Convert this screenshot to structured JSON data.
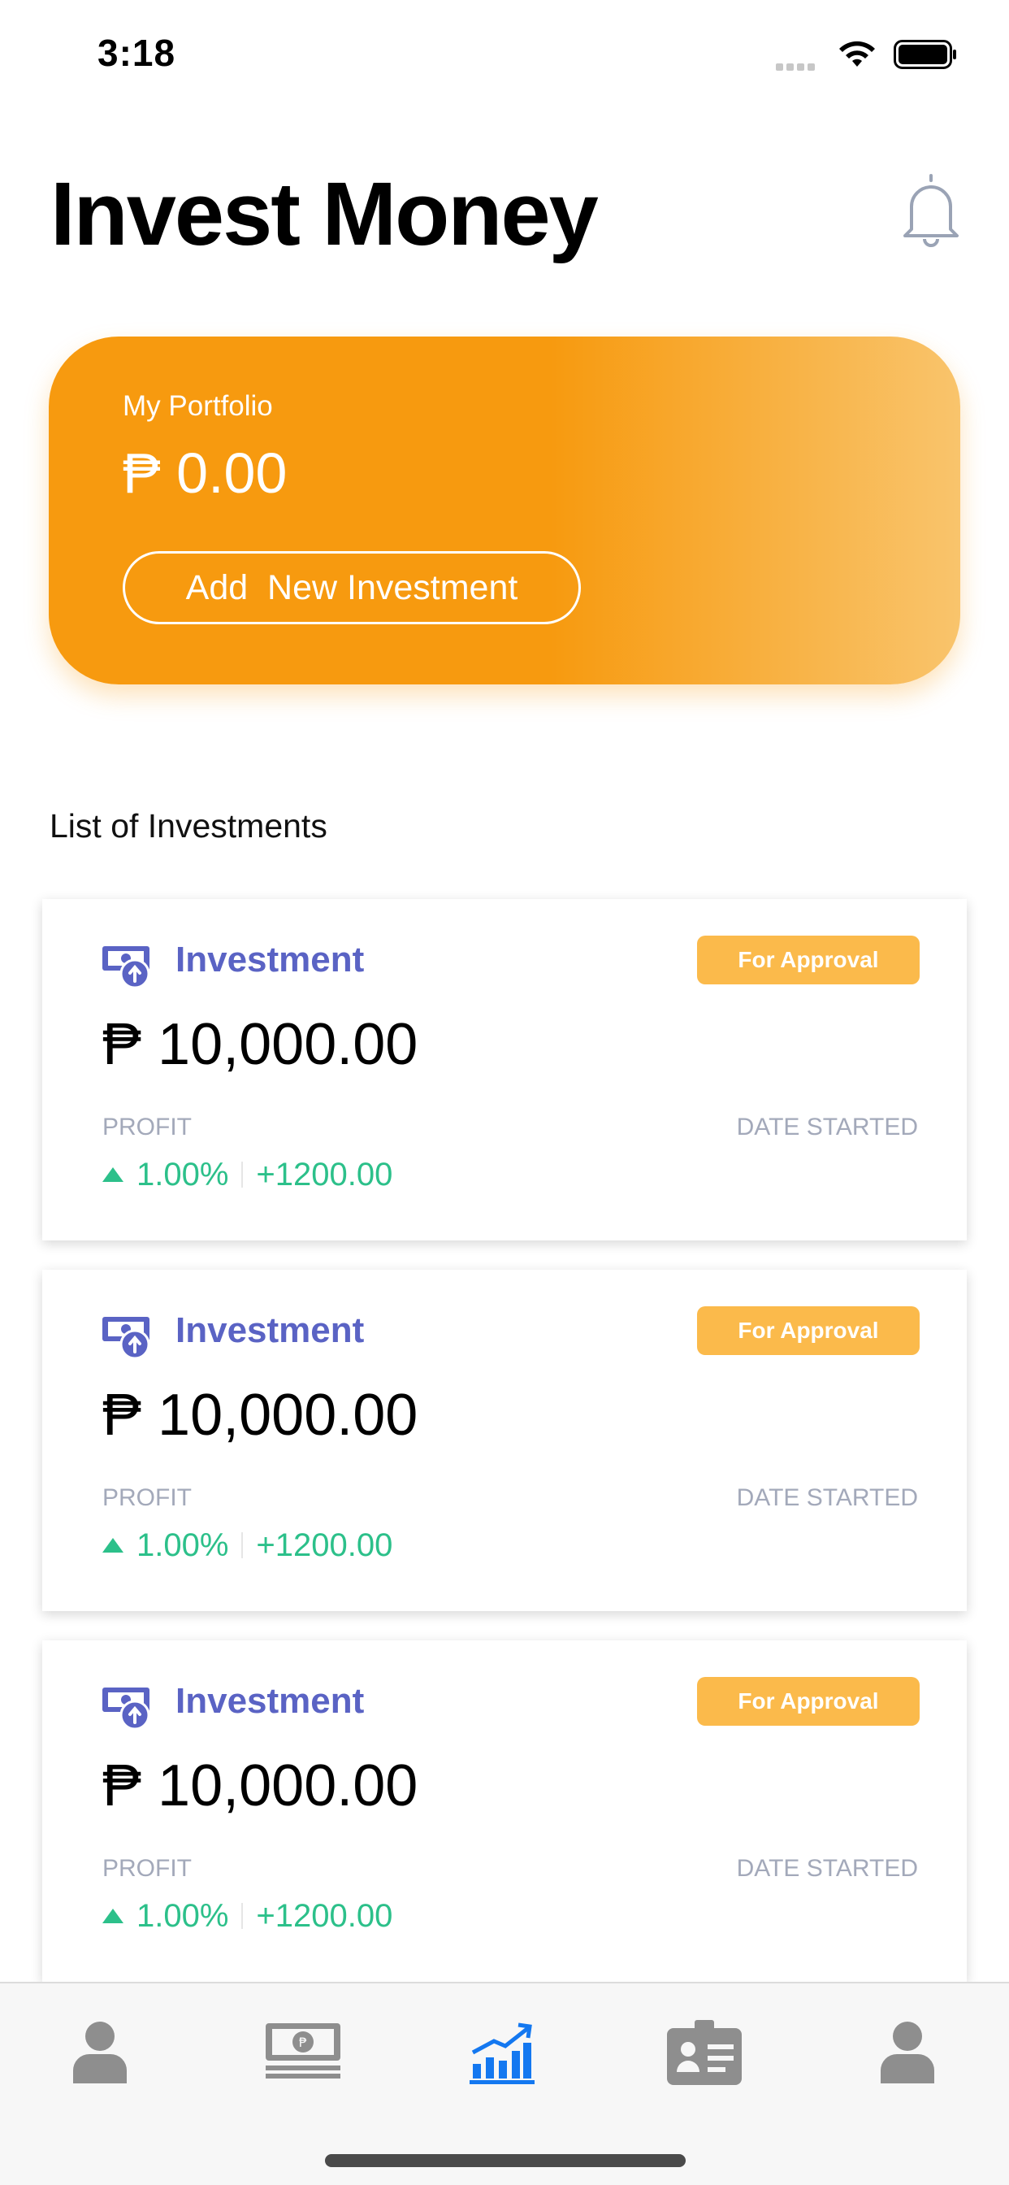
{
  "status_bar": {
    "time": "3:18"
  },
  "header": {
    "title": "Invest Money"
  },
  "portfolio": {
    "label": "My Portfolio",
    "amount": "₱ 0.00",
    "add_button_label": "Add  New Investment"
  },
  "list": {
    "title": "List of Investments",
    "items": [
      {
        "title": "Investment",
        "status": "For Approval",
        "amount": "₱ 10,000.00",
        "profit_label": "PROFIT",
        "date_label": "DATE STARTED",
        "profit_percent": "1.00%",
        "profit_value": "+1200.00"
      },
      {
        "title": "Investment",
        "status": "For Approval",
        "amount": "₱ 10,000.00",
        "profit_label": "PROFIT",
        "date_label": "DATE STARTED",
        "profit_percent": "1.00%",
        "profit_value": "+1200.00"
      },
      {
        "title": "Investment",
        "status": "For Approval",
        "amount": "₱ 10,000.00",
        "profit_label": "PROFIT",
        "date_label": "DATE STARTED",
        "profit_percent": "1.00%",
        "profit_value": "+1200.00"
      }
    ]
  },
  "tab_bar": {
    "tabs": [
      {
        "icon": "user-icon",
        "active": false
      },
      {
        "icon": "money-stack-icon",
        "active": false
      },
      {
        "icon": "growth-chart-icon",
        "active": true
      },
      {
        "icon": "id-card-icon",
        "active": false
      },
      {
        "icon": "profile-icon",
        "active": false
      }
    ]
  },
  "colors": {
    "accent_orange": "#f79a0f",
    "badge_yellow": "#fbba4b",
    "investment_blue": "#5a63c4",
    "profit_green": "#2cc08a",
    "active_tab_blue": "#1478f0",
    "inactive_tab_gray": "#8e8e8e"
  }
}
